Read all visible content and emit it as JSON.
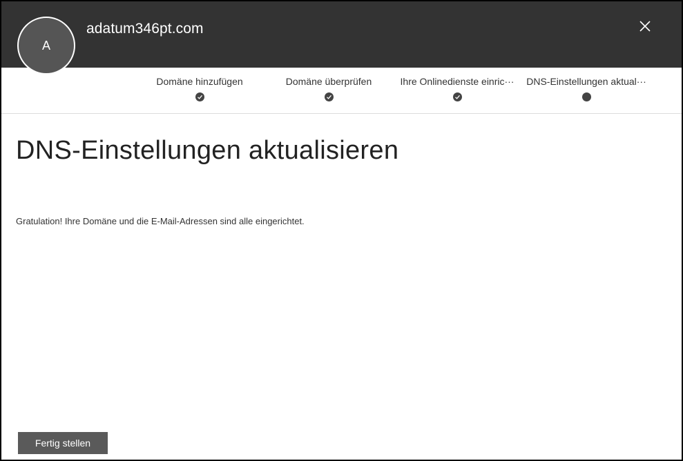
{
  "header": {
    "avatar_initial": "A",
    "title": "adatum346pt.com",
    "close_icon": "close-icon"
  },
  "steps": [
    {
      "label": "Domäne hinzufügen",
      "status": "completed",
      "icon": "checkmark-icon"
    },
    {
      "label": "Domäne überprüfen",
      "status": "completed",
      "icon": "checkmark-icon"
    },
    {
      "label": "Ihre Onlinedienste einric···",
      "status": "completed",
      "icon": "checkmark-icon"
    },
    {
      "label": "DNS-Einstellungen aktual···",
      "status": "current",
      "icon": "dot-icon"
    }
  ],
  "main": {
    "title": "DNS-Einstellungen aktualisieren",
    "message": "Gratulation! Ihre Domäne und die E-Mail-Adressen sind alle eingerichtet."
  },
  "footer": {
    "finish_label": "Fertig stellen"
  },
  "colors": {
    "header_bg": "#333333",
    "button_bg": "#5a5a5a",
    "step_dot": "#444444"
  }
}
